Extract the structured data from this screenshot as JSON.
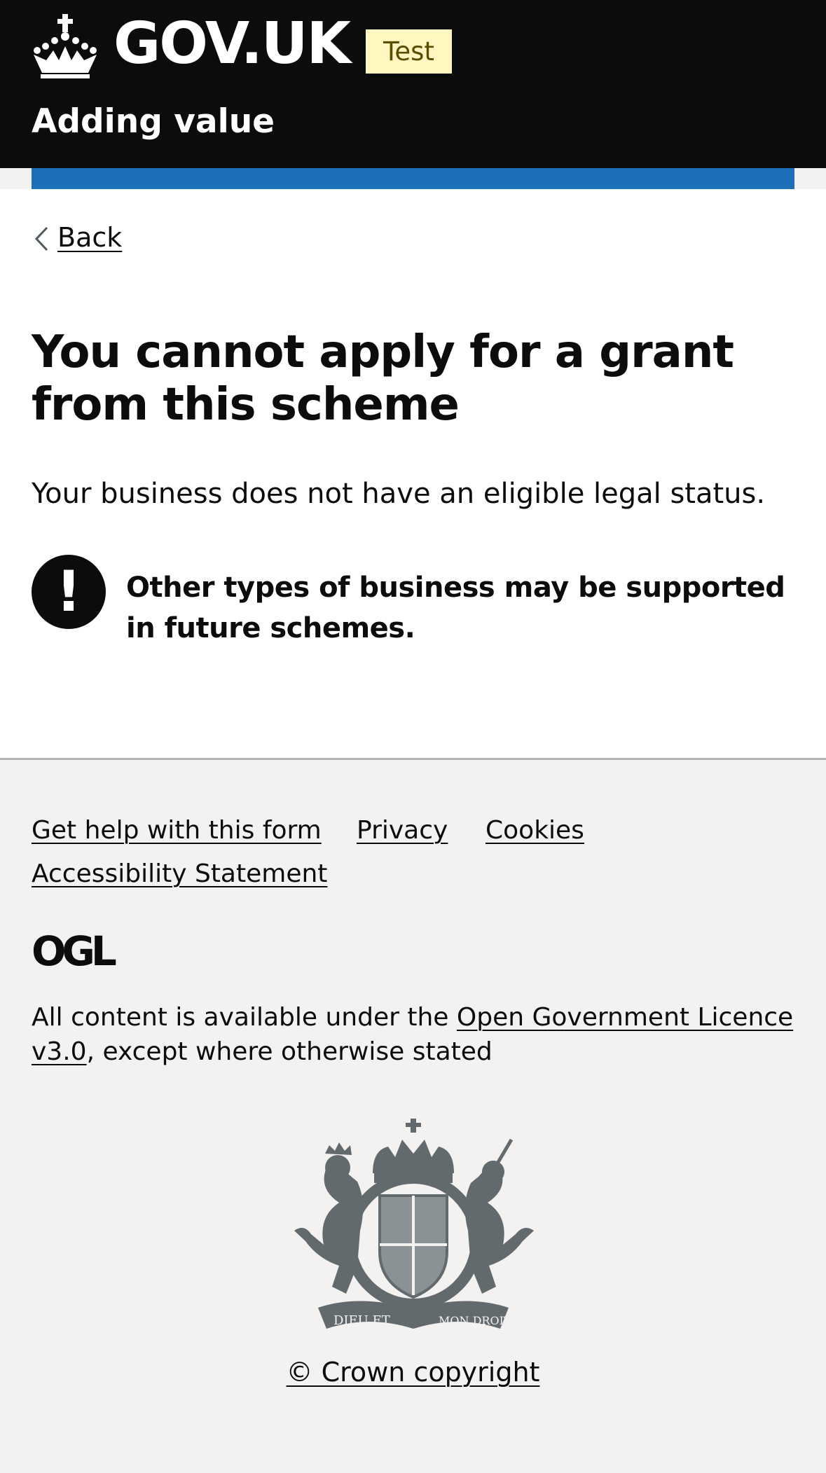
{
  "header": {
    "logo_text": "GOV.UK",
    "phase_tag": "Test",
    "service_name": "Adding value"
  },
  "colors": {
    "header_bg": "#0b0c0c",
    "accent_bar": "#1d70b8",
    "tag_bg": "#fff7bf",
    "footer_bg": "#f3f2f1"
  },
  "back_link": "Back",
  "main": {
    "heading": "You cannot apply for a grant from this scheme",
    "body": "Your business does not have an eligible legal status.",
    "warning_icon": "!",
    "warning_text": "Other types of business may be supported in future schemes."
  },
  "footer": {
    "links": [
      "Get help with this form",
      "Privacy",
      "Cookies",
      "Accessibility Statement"
    ],
    "ogl_logo": "OGL",
    "licence_prefix": "All content is available under the ",
    "licence_link": "Open Government Licence v3.0",
    "licence_suffix": ", except where otherwise stated",
    "crest_mottos": [
      "DIEU ET",
      "MON DROIT"
    ],
    "copyright": "© Crown copyright"
  },
  "icons": [
    "crown-icon",
    "chevron-left-icon",
    "warning-icon",
    "ogl-logo",
    "royal-coat-of-arms"
  ]
}
